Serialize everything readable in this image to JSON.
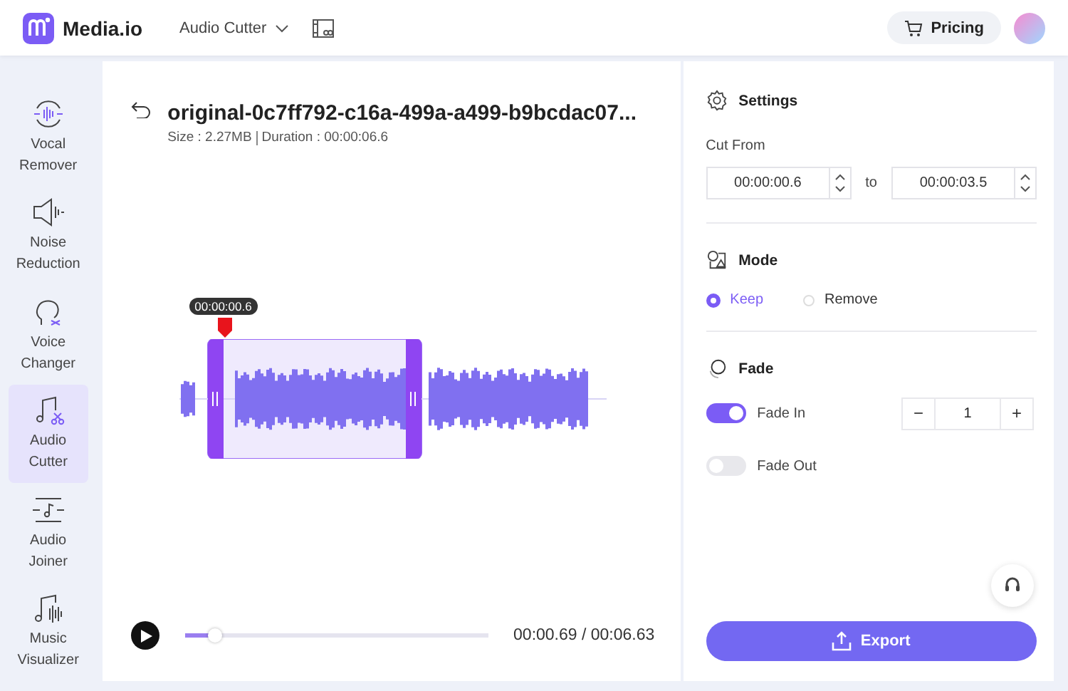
{
  "header": {
    "logo": "Media.io",
    "tool_menu": "Audio Cutter",
    "pricing": "Pricing"
  },
  "sidebar": {
    "items": [
      {
        "label": "Vocal Remover",
        "selected": false
      },
      {
        "label": "Noise Reduction",
        "selected": false
      },
      {
        "label": "Voice Changer",
        "selected": false
      },
      {
        "label": "Audio Cutter",
        "selected": true
      },
      {
        "label": "Audio Joiner",
        "selected": false
      },
      {
        "label": "Music Visualizer",
        "selected": false
      }
    ]
  },
  "file": {
    "title": "original-0c7ff792-c16a-499a-a499-b9bcdac07...",
    "size": "Size : 2.27MB",
    "duration": "Duration : 00:00:06.6"
  },
  "editor": {
    "marker_time": "00:00:00.6"
  },
  "player": {
    "level": 0.1,
    "time": "00:00.69 / 00:06.63"
  },
  "settings": {
    "title": "Settings",
    "cut_from": "Cut From",
    "from": "00:00:00.6",
    "to_label": "to",
    "to": "00:00:03.5"
  },
  "mode": {
    "title": "Mode",
    "options": [
      {
        "label": "Keep",
        "selected": true
      },
      {
        "label": "Remove",
        "selected": false
      }
    ]
  },
  "fade": {
    "title": "Fade",
    "toggles": [
      {
        "label": "Fade In",
        "on": true
      },
      {
        "label": "Fade Out",
        "on": false
      }
    ],
    "minus": "−",
    "value": "1",
    "plus": "+"
  },
  "export": "Export"
}
